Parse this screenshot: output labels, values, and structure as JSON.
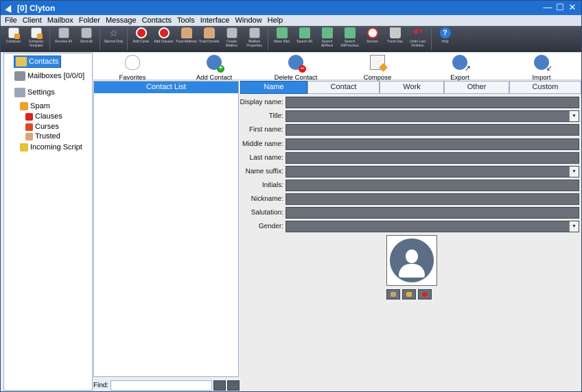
{
  "window": {
    "title": "[0] Clyton",
    "controls": {
      "minimize": "—",
      "maximize": "☐",
      "close": "✕"
    }
  },
  "menu": [
    "File",
    "Client",
    "Mailbox",
    "Folder",
    "Message",
    "Contacts",
    "Tools",
    "Interface",
    "Window",
    "Help"
  ],
  "toolbar": [
    {
      "label": "Compose",
      "icon": "compose-icon"
    },
    {
      "label": "Compose Template",
      "icon": "compose-template-icon"
    },
    {
      "label": "Receive All",
      "icon": "receive-all-icon"
    },
    {
      "label": "Send All",
      "icon": "send-all-icon"
    },
    {
      "label": "Starred Only",
      "icon": "star-icon"
    },
    {
      "label": "Add Curse",
      "icon": "add-curse-icon"
    },
    {
      "label": "Add Clauses",
      "icon": "add-clauses-icon"
    },
    {
      "label": "Trust Address",
      "icon": "trust-address-icon"
    },
    {
      "label": "Trust Domain",
      "icon": "trust-domain-icon"
    },
    {
      "label": "Create Mailbox",
      "icon": "create-mailbox-icon"
    },
    {
      "label": "Mailbox Properties",
      "icon": "mailbox-properties-icon"
    },
    {
      "label": "Mass Mail",
      "icon": "mass-mail-icon"
    },
    {
      "label": "Search All",
      "icon": "search-all-icon"
    },
    {
      "label": "Search All/Next",
      "icon": "search-next-icon"
    },
    {
      "label": "Search All/Previous",
      "icon": "search-previous-icon"
    },
    {
      "label": "Snooze",
      "icon": "snooze-icon"
    },
    {
      "label": "Trash Day",
      "icon": "trash-icon"
    },
    {
      "label": "Undo Last Deletion",
      "icon": "undo-icon"
    },
    {
      "label": "Help",
      "icon": "help-icon"
    }
  ],
  "sidebar": {
    "contacts": "Contacts",
    "mailboxes": "Mailboxes [0/0/0]",
    "settings": "Settings",
    "spam": "Spam",
    "clauses": "Clauses",
    "curses": "Curses",
    "trusted": "Trusted",
    "incoming_script": "Incoming Script"
  },
  "actions": {
    "favorites": "Favorites",
    "add_contact": "Add Contact",
    "delete_contact": "Delete Contact",
    "compose": "Compose",
    "export": "Export",
    "import": "Import"
  },
  "contact_list": {
    "header": "Contact List"
  },
  "find": {
    "label": "Find:",
    "value": ""
  },
  "tabs": [
    "Name",
    "Contact",
    "Work",
    "Other",
    "Custom"
  ],
  "form": {
    "display_name": "Display name:",
    "title": "Title:",
    "first_name": "First name:",
    "middle_name": "Middle name:",
    "last_name": "Last name:",
    "name_suffix": "Name suffix:",
    "initials": "Initials:",
    "nickname": "Nickname:",
    "salutation": "Salutation:",
    "gender": "Gender:"
  },
  "colors": {
    "titlebar": "#1f6fd1",
    "selected": "#2f86e0",
    "toolbar": "#3a3f4a",
    "input": "#6a6f78",
    "avatar": "#5a6e86"
  }
}
